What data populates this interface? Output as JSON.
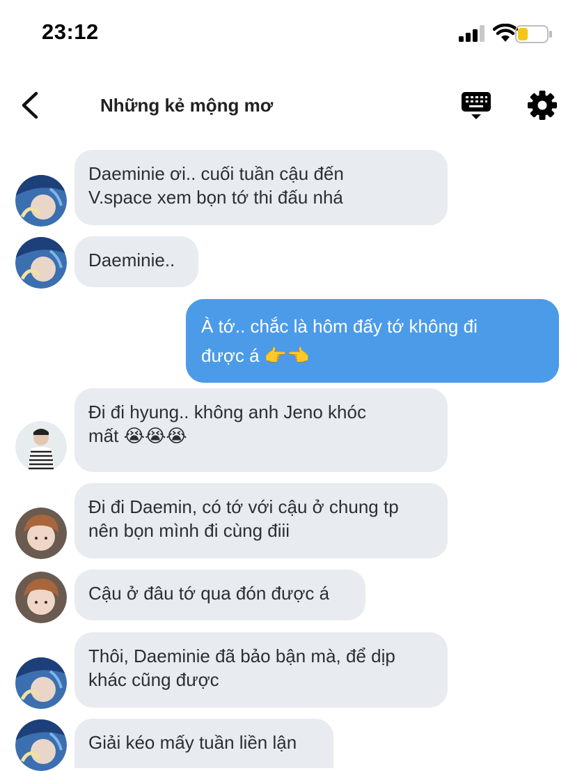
{
  "status": {
    "time": "23:12",
    "icons": [
      "signal-bars-icon",
      "wifi-icon",
      "battery-low-icon"
    ],
    "battery_color": "#f5c518"
  },
  "header": {
    "title": "Những kẻ mộng mơ",
    "back_icon": "chevron-left-icon",
    "keyboard_icon": "keyboard-icon",
    "settings_icon": "gear-icon"
  },
  "colors": {
    "incoming_bubble": "#e8ebef",
    "outgoing_bubble": "#4b9be8",
    "outgoing_text": "#ffffff"
  },
  "messages": [
    {
      "direction": "in",
      "avatar": "blue-cap-avatar",
      "text": "Daeminie ơi.. cuối tuần cậu đến\nV.space xem bọn tớ thi đấu nhá"
    },
    {
      "direction": "in",
      "avatar": "blue-cap-avatar",
      "text": "Daeminie.."
    },
    {
      "direction": "out",
      "text": "À tớ.. chắc là hôm đấy tớ không đi\nđược á 👉👈"
    },
    {
      "direction": "in",
      "avatar": "striped-shirt-avatar",
      "text": "Đi đi hyung.. không anh Jeno khóc\nmất 😭😭😭"
    },
    {
      "direction": "in",
      "avatar": "brown-hair-avatar",
      "text": "Đi đi Daemin, có tớ với cậu ở chung tp\nnên bọn mình đi cùng điii"
    },
    {
      "direction": "in",
      "avatar": "brown-hair-avatar",
      "text": "Cậu ở đâu tớ qua đón được á"
    },
    {
      "direction": "in",
      "avatar": "blue-cap-avatar",
      "text": "Thôi, Daeminie đã bảo bận mà, để dịp\nkhác cũng được"
    },
    {
      "direction": "in",
      "avatar": "blue-cap-avatar",
      "text": "Giải kéo mấy tuần liền lận"
    }
  ]
}
